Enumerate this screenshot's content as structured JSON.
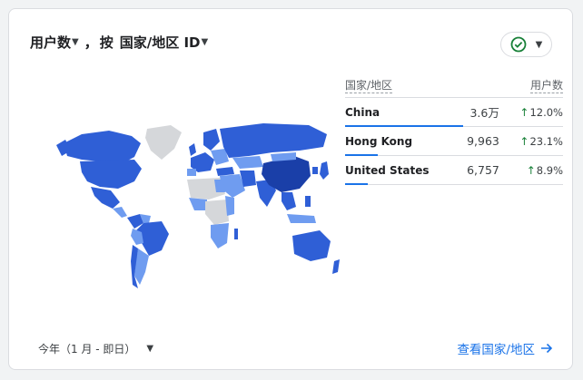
{
  "header": {
    "metric_label": "用户数",
    "separator": "，",
    "by_label": "按",
    "dimension_label": "国家/地区 ID"
  },
  "table": {
    "col_country": "国家/地区",
    "col_users": "用户数",
    "rows": [
      {
        "country": "China",
        "users": "3.6万",
        "change": "12.0%",
        "share": 1.0
      },
      {
        "country": "Hong Kong",
        "users": "9,963",
        "change": "23.1%",
        "share": 0.28
      },
      {
        "country": "United States",
        "users": "6,757",
        "change": "8.9%",
        "share": 0.19
      }
    ]
  },
  "footer": {
    "date_range": "今年（1 月 - 即日）",
    "view_link": "查看国家/地区"
  },
  "icons": {
    "status": "check-circle-icon",
    "dropdown": "chevron-down-icon",
    "link_arrow": "arrow-right-icon"
  },
  "colors": {
    "accent": "#1a73e8",
    "positive": "#188038",
    "map_dark": "#1a3fa8",
    "map_mid": "#2f5fd6",
    "map_light": "#6f9cf0",
    "map_none": "#d5d7da"
  }
}
